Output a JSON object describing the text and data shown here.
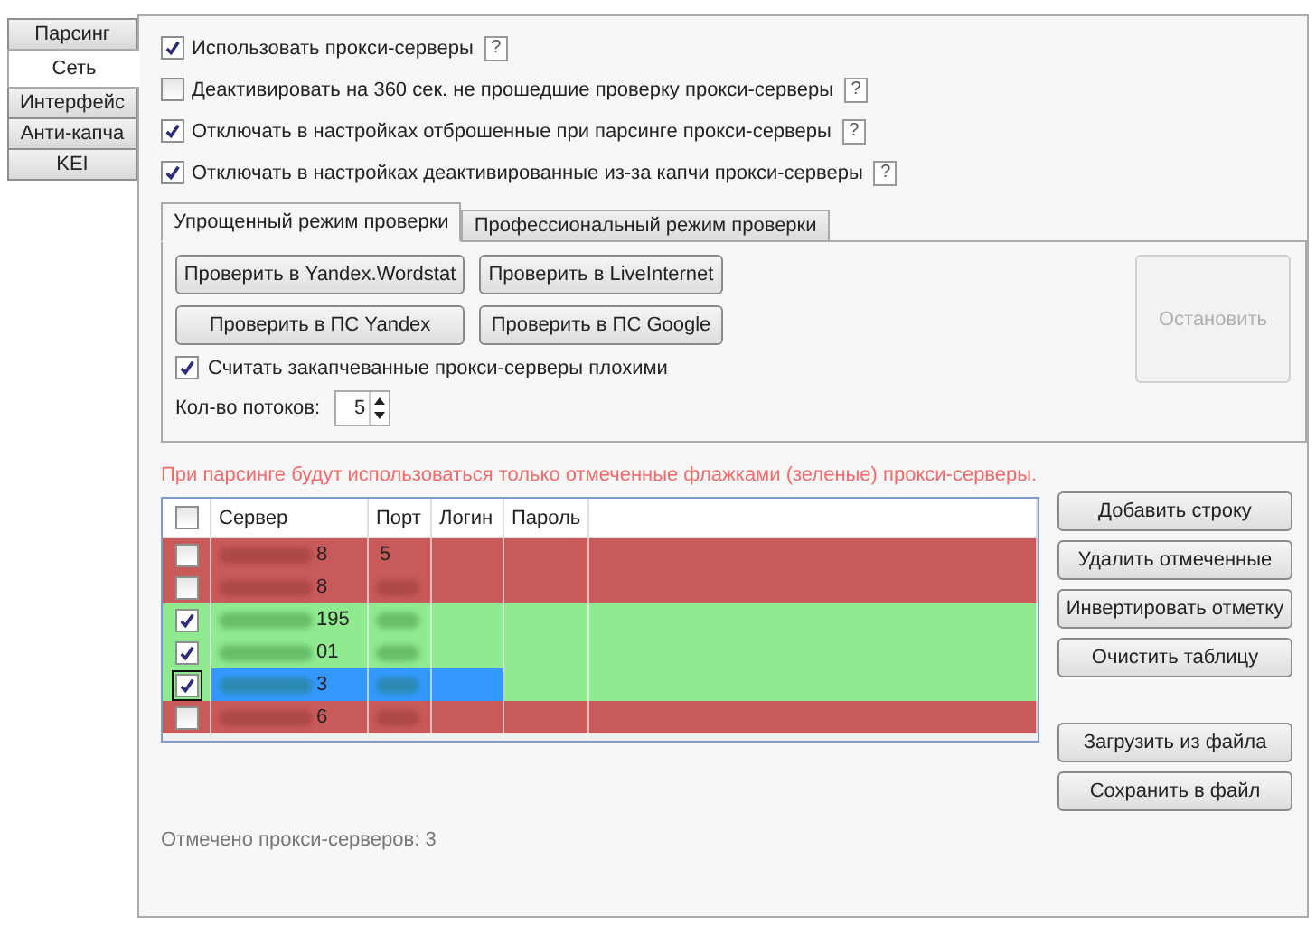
{
  "side_tabs": [
    {
      "label": "Парсинг",
      "selected": false
    },
    {
      "label": "Сеть",
      "selected": true
    },
    {
      "label": "Интерфейс",
      "selected": false
    },
    {
      "label": "Анти-капча",
      "selected": false
    },
    {
      "label": "KEI",
      "selected": false
    }
  ],
  "options": [
    {
      "label": "Использовать прокси-серверы",
      "checked": true,
      "help": "?"
    },
    {
      "label": "Деактивировать на 360 сек. не прошедшие проверку прокси-серверы",
      "checked": false,
      "help": "?"
    },
    {
      "label": "Отключать в настройках отброшенные при парсинге прокси-серверы",
      "checked": true,
      "help": "?"
    },
    {
      "label": "Отключать в настройках деактивированные из-за капчи прокси-серверы",
      "checked": true,
      "help": "?"
    }
  ],
  "check_tabs": [
    {
      "label": "Упрощенный режим проверки",
      "selected": true
    },
    {
      "label": "Профессиональный режим проверки",
      "selected": false
    }
  ],
  "check_buttons": [
    {
      "label": "Проверить в Yandex.Wordstat",
      "disabled": false
    },
    {
      "label": "Проверить в LiveInternet",
      "disabled": false
    },
    {
      "label": "Проверить в ПС Yandex",
      "disabled": false
    },
    {
      "label": "Проверить в ПС Google",
      "disabled": false
    }
  ],
  "stop_button": {
    "label": "Остановить",
    "disabled": true
  },
  "bad_captcha": {
    "label": "Считать закапчеванные прокси-серверы плохими",
    "checked": true
  },
  "threads": {
    "label": "Кол-во потоков:",
    "value": "5"
  },
  "notice": "При парсинге будут использоваться только отмеченные флажками (зеленые) прокси-серверы.",
  "table": {
    "header_checked": false,
    "columns": [
      "Сервер",
      "Порт",
      "Логин",
      "Пароль"
    ],
    "rows": [
      {
        "checked": false,
        "selected": false,
        "server": "8",
        "port": "5"
      },
      {
        "checked": false,
        "selected": false,
        "server": "8",
        "port": ""
      },
      {
        "checked": true,
        "selected": false,
        "server": "195",
        "port": ""
      },
      {
        "checked": true,
        "selected": false,
        "server": "01",
        "port": ""
      },
      {
        "checked": true,
        "selected": true,
        "server": "3",
        "port": ""
      },
      {
        "checked": false,
        "selected": false,
        "server": "6",
        "port": ""
      }
    ]
  },
  "table_buttons": [
    "Добавить строку",
    "Удалить отмеченные",
    "Инвертировать отметку",
    "Очистить таблицу"
  ],
  "file_buttons": [
    "Загрузить из файла",
    "Сохранить в файл"
  ],
  "status": "Отмечено прокси-серверов: 3"
}
